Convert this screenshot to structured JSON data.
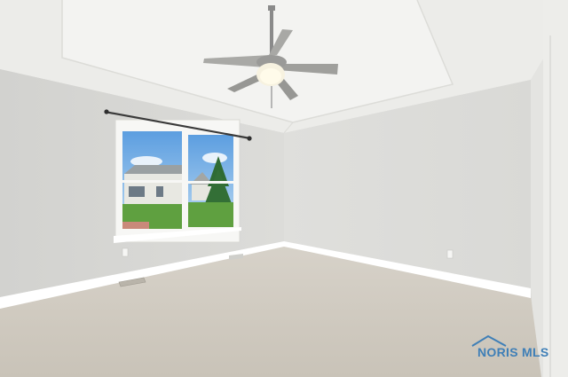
{
  "photo": {
    "scene": "empty-bedroom",
    "watermark": {
      "text": "NORIS MLS",
      "color": "#3f7fb7"
    },
    "colors": {
      "walls": "#d8d8d5",
      "ceiling": "#f0f0ee",
      "carpet": "#cfcac1",
      "trim": "#ffffff",
      "sky": "#7fb4e6",
      "grass": "#5fa040"
    }
  }
}
